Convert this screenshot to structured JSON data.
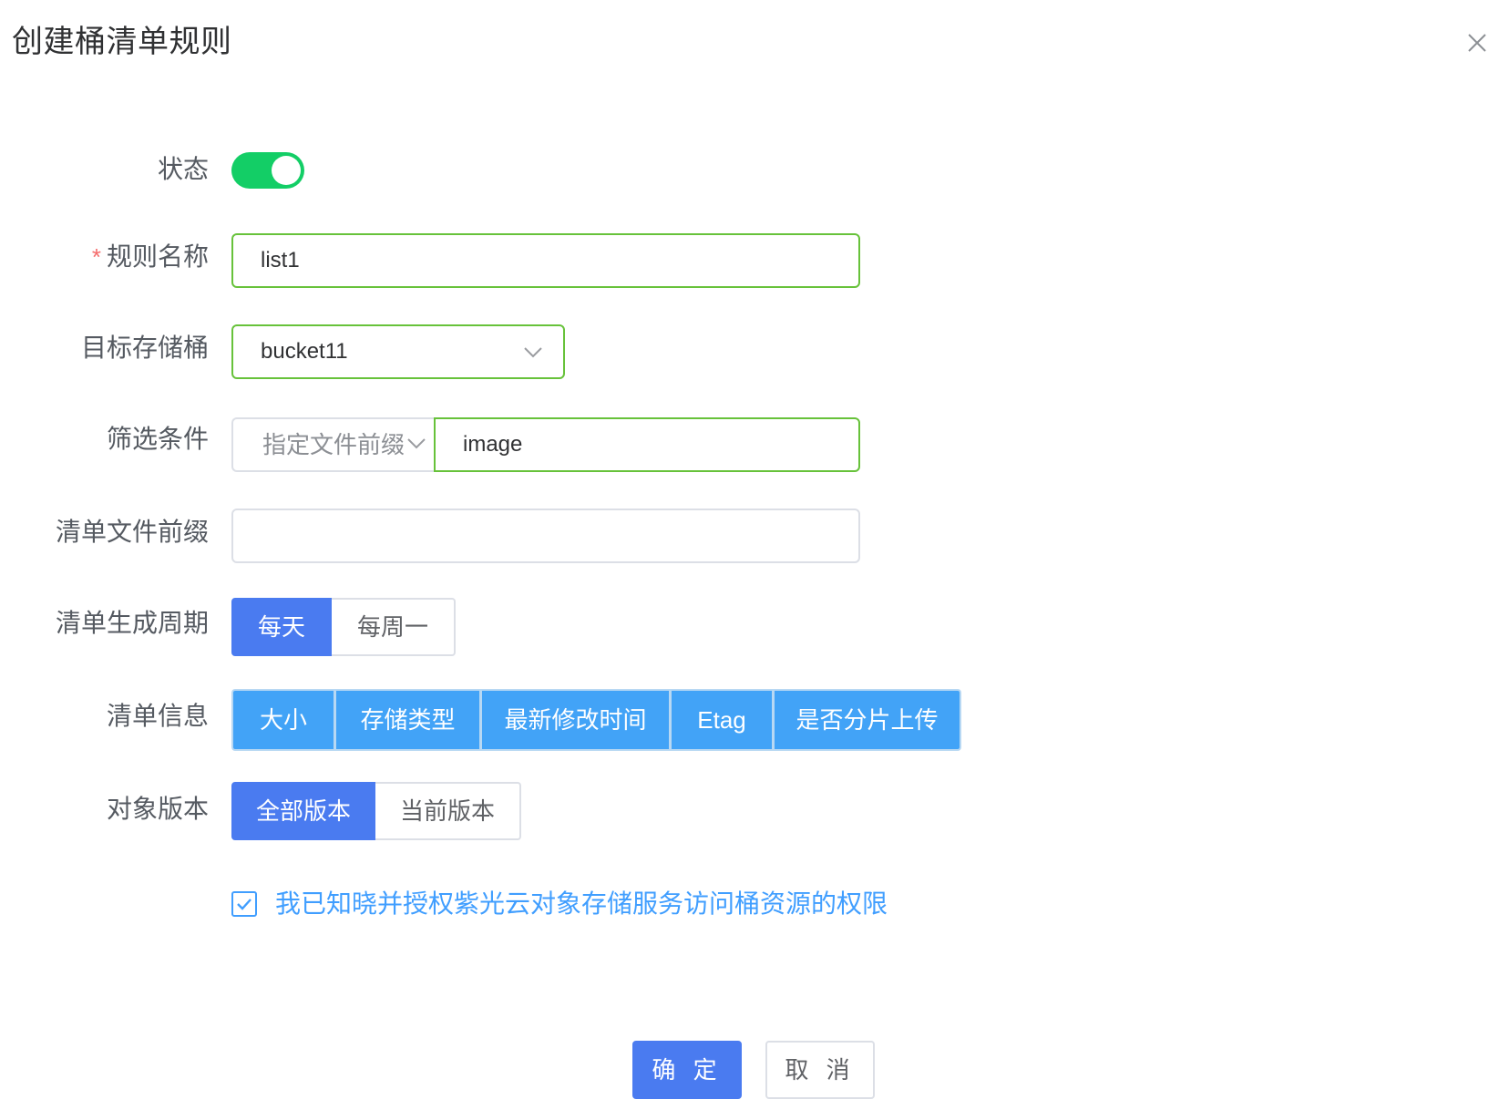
{
  "dialog": {
    "title": "创建桶清单规则",
    "close_icon": "close-icon"
  },
  "form": {
    "status": {
      "label": "状态",
      "enabled": true,
      "on_color": "#13ce66"
    },
    "rule_name": {
      "required_mark": "*",
      "label": "规则名称",
      "value": "list1"
    },
    "target_bucket": {
      "label": "目标存储桶",
      "value": "bucket11",
      "icon": "chevron-down-icon"
    },
    "filter": {
      "label": "筛选条件",
      "type_value": "指定文件前缀",
      "type_icon": "chevron-down-icon",
      "value": "image"
    },
    "inventory_prefix": {
      "label": "清单文件前缀",
      "value": ""
    },
    "frequency": {
      "label": "清单生成周期",
      "options": [
        "每天",
        "每周一"
      ],
      "selected": "每天"
    },
    "info": {
      "label": "清单信息",
      "options": [
        "大小",
        "存储类型",
        "最新修改时间",
        "Etag",
        "是否分片上传"
      ]
    },
    "versions": {
      "label": "对象版本",
      "options": [
        "全部版本",
        "当前版本"
      ],
      "selected": "全部版本"
    },
    "agreement": {
      "checked": true,
      "text": "我已知晓并授权紫光云对象存储服务访问桶资源的权限"
    }
  },
  "footer": {
    "confirm_label": "确 定",
    "cancel_label": "取 消"
  },
  "colors": {
    "primary": "#4a7bf0",
    "info_button": "#42a3f7",
    "valid_border": "#67c23a",
    "link": "#409eff"
  }
}
